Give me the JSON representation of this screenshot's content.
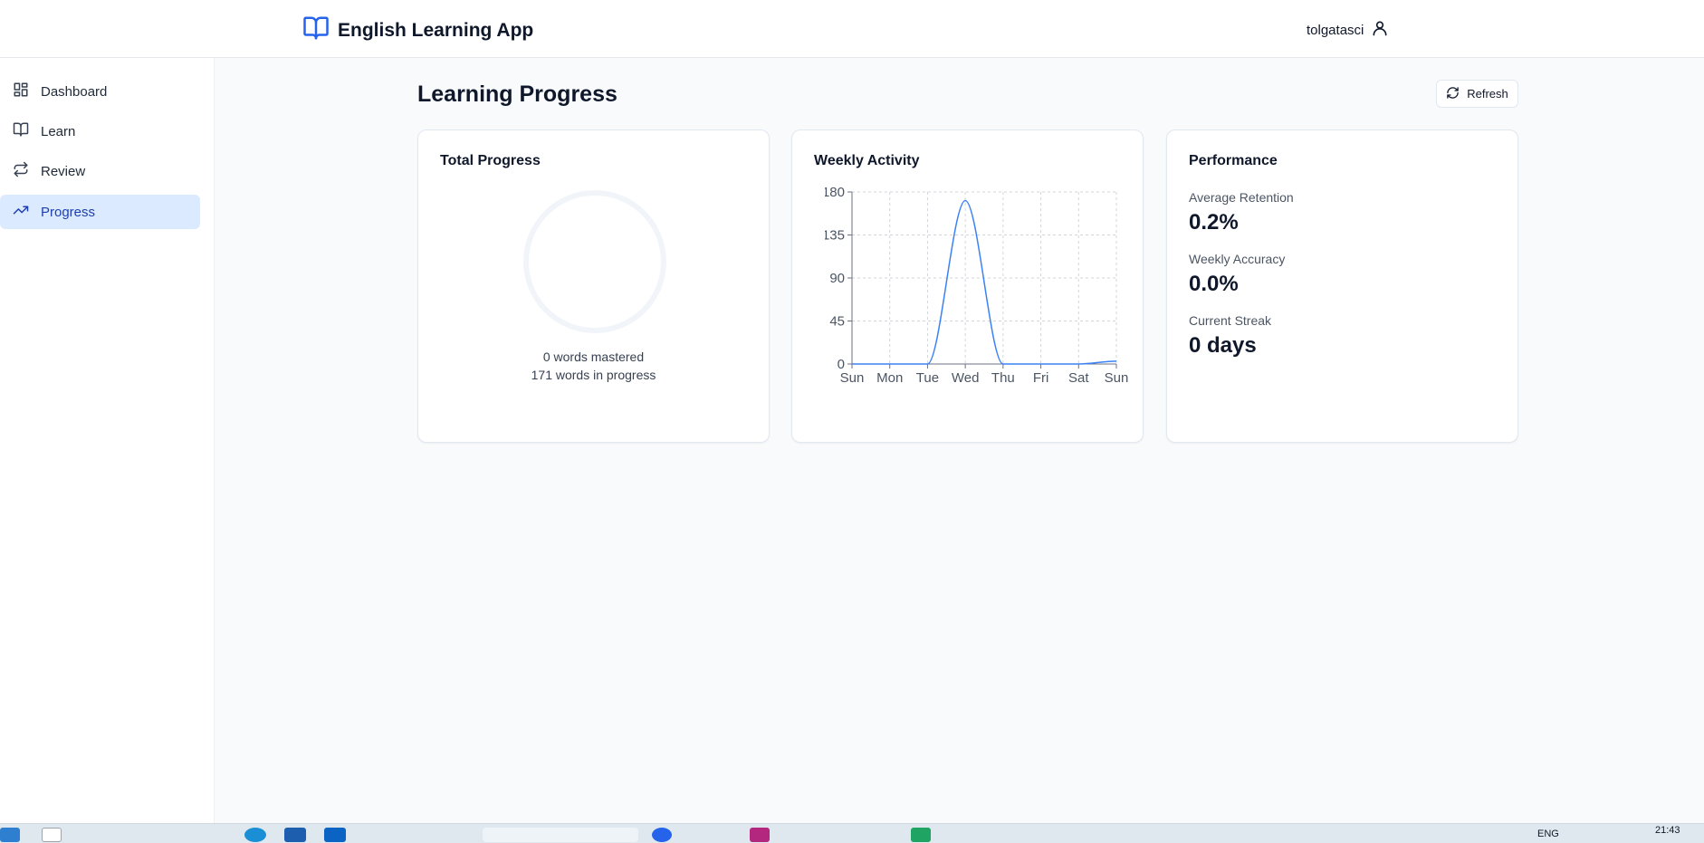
{
  "app": {
    "title": "English Learning App",
    "username": "tolgatasci"
  },
  "sidebar": {
    "items": [
      {
        "label": "Dashboard",
        "icon": "grid-icon",
        "active": false
      },
      {
        "label": "Learn",
        "icon": "book-icon",
        "active": false
      },
      {
        "label": "Review",
        "icon": "repeat-icon",
        "active": false
      },
      {
        "label": "Progress",
        "icon": "trending-up-icon",
        "active": true
      }
    ]
  },
  "main": {
    "title": "Learning Progress",
    "refresh_label": "Refresh"
  },
  "total_progress": {
    "title": "Total Progress",
    "mastered": "0 words mastered",
    "in_progress": "171 words in progress",
    "fraction": 0
  },
  "weekly_activity": {
    "title": "Weekly Activity"
  },
  "performance": {
    "title": "Performance",
    "retention_label": "Average Retention",
    "retention_value": "0.2%",
    "accuracy_label": "Weekly Accuracy",
    "accuracy_value": "0.0%",
    "streak_label": "Current Streak",
    "streak_value": "0 days"
  },
  "colors": {
    "accent": "#2563eb",
    "line": "#3b82f6",
    "active_bg": "#dbeafe",
    "active_text": "#1e40af"
  },
  "taskbar": {
    "lang": "ENG",
    "clock": "21:43"
  },
  "chart_data": {
    "type": "line",
    "title": "",
    "xlabel": "",
    "ylabel": "",
    "categories": [
      "Sun",
      "Mon",
      "Tue",
      "Wed",
      "Thu",
      "Fri",
      "Sat",
      "Sun"
    ],
    "series": [
      {
        "values": [
          0,
          0,
          0,
          171,
          0,
          0,
          0,
          3
        ]
      }
    ],
    "yticks": [
      0,
      45,
      90,
      135,
      180
    ],
    "ylim": [
      0,
      180
    ],
    "grid": true,
    "curve": "smooth"
  }
}
